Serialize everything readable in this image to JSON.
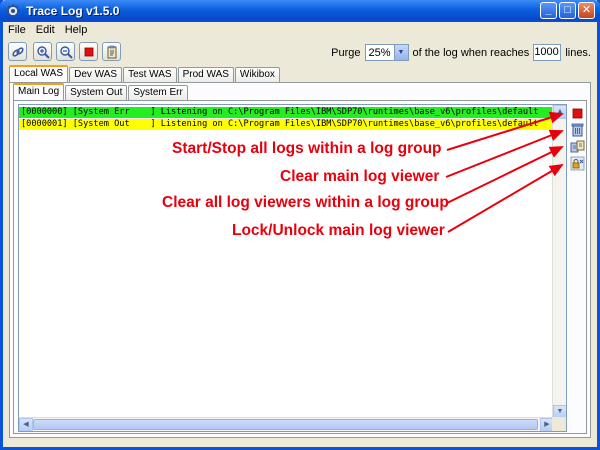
{
  "window": {
    "title": "Trace Log v1.5.0",
    "minimize": "_",
    "maximize": "□",
    "close": "✕"
  },
  "menu": [
    {
      "label": "File"
    },
    {
      "label": "Edit"
    },
    {
      "label": "Help"
    }
  ],
  "toolbar": {
    "buttons": [
      "link-icon",
      "zoom-in-icon",
      "zoom-out-icon",
      "stop-icon",
      "clipboard-icon"
    ],
    "purge_label": "Purge",
    "purge_value": "25%",
    "purge_mid": "of the log when reaches",
    "purge_lines": "1000",
    "purge_unit": "lines."
  },
  "group_tabs": [
    {
      "label": "Local WAS",
      "active": true
    },
    {
      "label": "Dev WAS"
    },
    {
      "label": "Test WAS"
    },
    {
      "label": "Prod WAS"
    },
    {
      "label": "Wikibox"
    }
  ],
  "log_tabs": [
    {
      "label": "Main Log",
      "active": true
    },
    {
      "label": "System Out"
    },
    {
      "label": "System Err"
    }
  ],
  "log_lines": [
    {
      "text": "[0000000] [System Err    ] Listening on C:\\Program Files\\IBM\\SDP70\\runtimes\\base_v6\\profiles\\default",
      "color": "#22ee22"
    },
    {
      "text": "[0000001] [System Out    ] Listening on C:\\Program Files\\IBM\\SDP70\\runtimes\\base_v6\\profiles\\default",
      "color": "#ffff00"
    }
  ],
  "annotations": {
    "start_stop": "Start/Stop all logs within a log group",
    "clear_main": "Clear main log viewer",
    "clear_all": "Clear all log viewers within a log group",
    "lock_unlock": "Lock/Unlock main log viewer",
    "color": "#e8000d"
  },
  "colors": {
    "titlebar": "#0a52d8",
    "window_bg": "#ece9d8"
  }
}
